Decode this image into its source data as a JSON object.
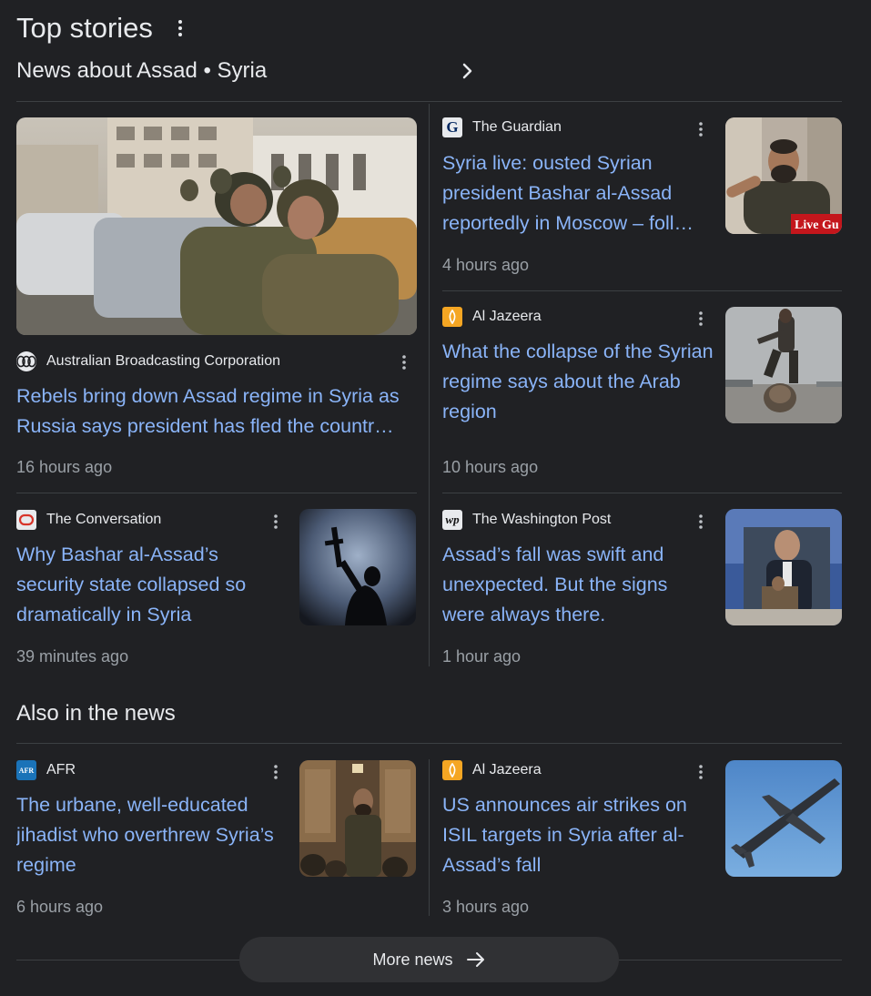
{
  "header": {
    "title": "Top stories",
    "subtitle": "News about Assad • Syria"
  },
  "stories": [
    {
      "source": "Australian Broadcasting Corporation",
      "source_icon": "abc-logo",
      "headline": "Rebels bring down Assad regime in Syria as Russia says president has fled the countr…",
      "time": "16 hours ago",
      "image": "rebels-in-vehicles-photo"
    },
    {
      "source": "The Guardian",
      "source_icon": "guardian-logo",
      "headline": "Syria live: ousted Syrian president Bashar al-Assad reportedly in Moscow – foll…",
      "time": "4 hours ago",
      "image": "man-in-crowd-photo",
      "image_badge": "Live Gu"
    },
    {
      "source": "Al Jazeera",
      "source_icon": "aljazeera-logo",
      "headline": "What the collapse of the Syrian regime says about the Arab region",
      "time": "10 hours ago",
      "image": "toppled-statue-photo"
    },
    {
      "source": "The Conversation",
      "source_icon": "conversation-logo",
      "headline": "Why Bashar al-Assad’s security state collapsed so dramatically in Syria",
      "time": "39 minutes ago",
      "image": "silhouette-rifle-photo"
    },
    {
      "source": "The Washington Post",
      "source_icon": "wapo-logo",
      "headline": "Assad’s fall was swift and unexpected. But the signs were always there.",
      "time": "1 hour ago",
      "image": "assad-poster-photo"
    }
  ],
  "also": {
    "title": "Also in the news",
    "stories": [
      {
        "source": "AFR",
        "source_icon": "afr-logo",
        "headline": "The urbane, well-educated jihadist who overthrew Syria’s regime",
        "time": "6 hours ago",
        "image": "speaker-in-mosque-photo"
      },
      {
        "source": "Al Jazeera",
        "source_icon": "aljazeera-logo",
        "headline": "US announces air strikes on ISIL targets in Syria after al-Assad’s fall",
        "time": "3 hours ago",
        "image": "military-aircraft-photo"
      }
    ]
  },
  "more_button": "More news",
  "colors": {
    "background": "#202124",
    "link": "#8ab4f8",
    "text": "#e8eaed",
    "muted": "#9aa0a6",
    "divider": "#3c4043"
  }
}
